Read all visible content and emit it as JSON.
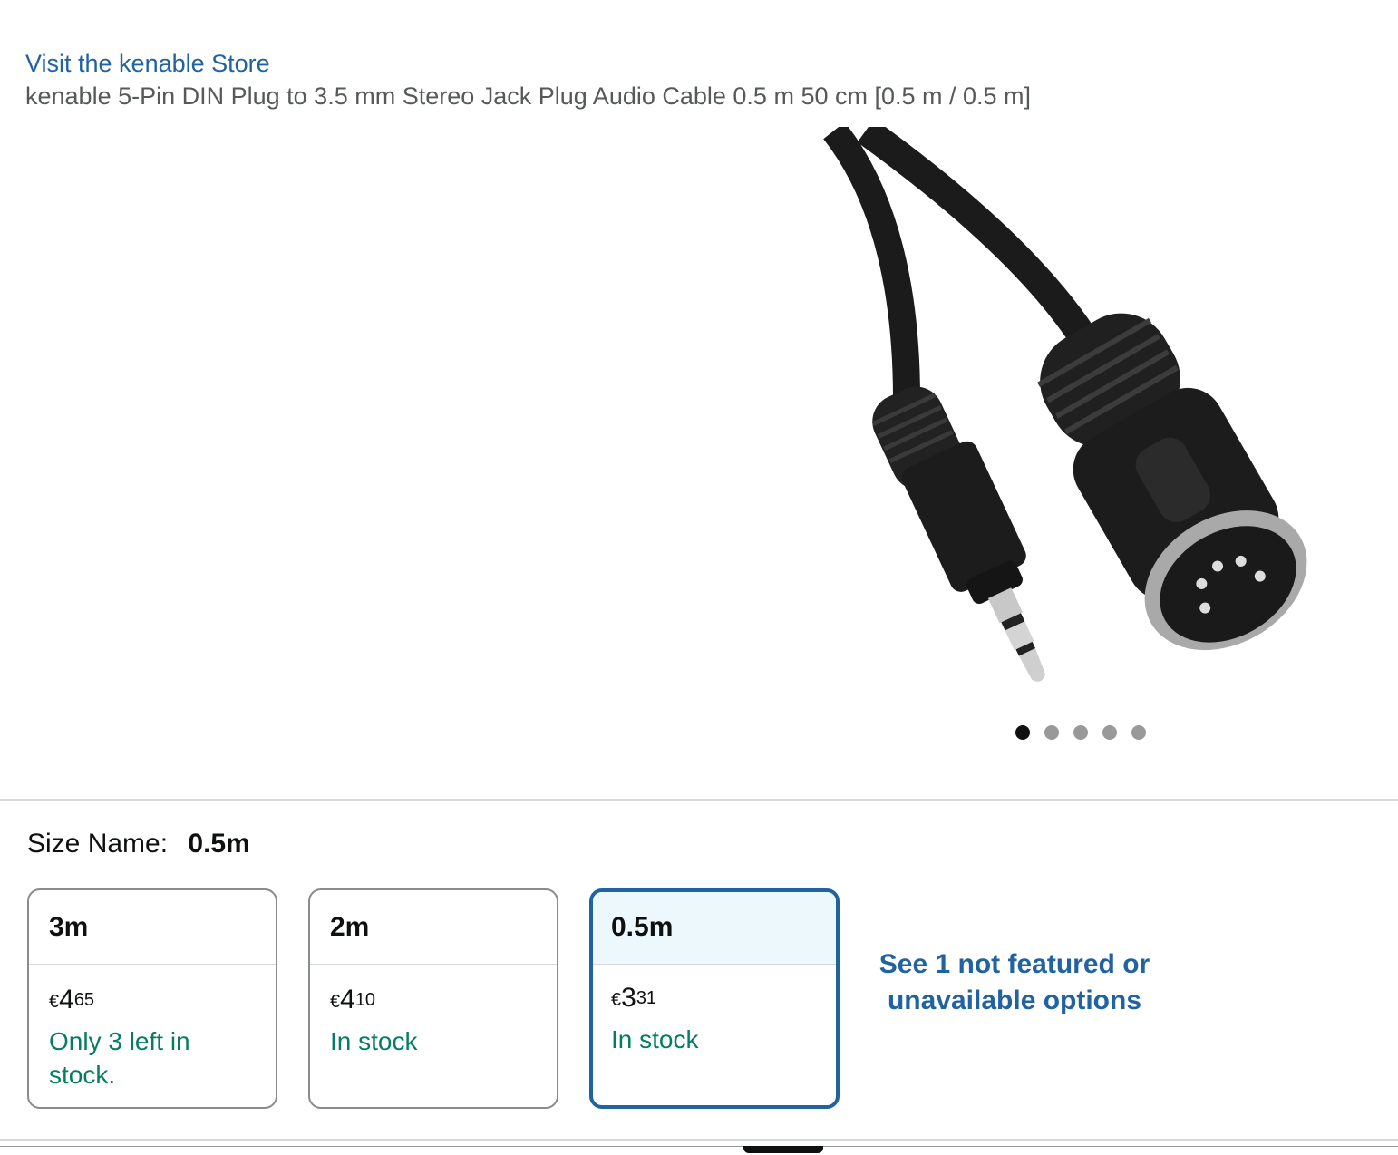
{
  "store": {
    "link_text": "Visit the kenable Store"
  },
  "product": {
    "title": "kenable 5-Pin DIN Plug to 3.5 mm Stereo Jack Plug Audio Cable 0.5 m 50 cm [0.5 m / 0.5 m]"
  },
  "gallery": {
    "image_count": 5,
    "active_index": 0
  },
  "size": {
    "label": "Size Name:",
    "selected_value": "0.5m",
    "options": [
      {
        "name": "3m",
        "currency": "€",
        "whole": "4",
        "fraction": "65",
        "stock": "Only 3 left in stock.",
        "selected": false
      },
      {
        "name": "2m",
        "currency": "€",
        "whole": "4",
        "fraction": "10",
        "stock": "In stock",
        "selected": false
      },
      {
        "name": "0.5m",
        "currency": "€",
        "whole": "3",
        "fraction": "31",
        "stock": "In stock",
        "selected": true
      }
    ],
    "see_more": "See 1 not featured or unavailable options"
  },
  "colors": {
    "link": "#2162A1",
    "in_stock": "#067D62",
    "selected_bg": "#EDF8FD"
  }
}
